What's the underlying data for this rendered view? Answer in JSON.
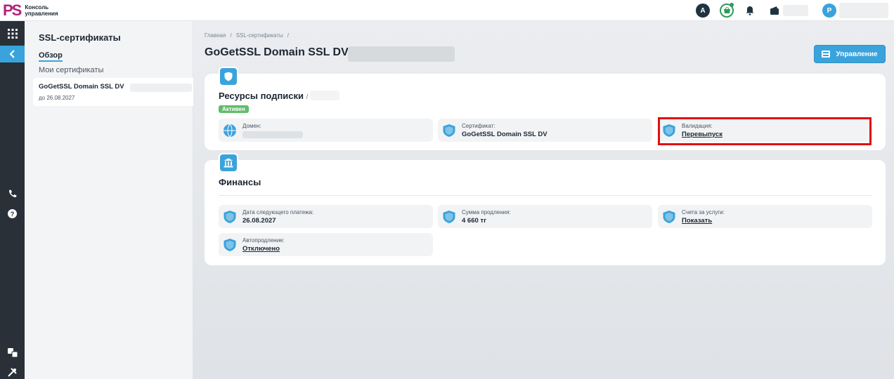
{
  "header": {
    "logo_mark": "PS",
    "logo_text_line1": "Консоль",
    "logo_text_line2": "управления",
    "account_initial": "A",
    "user_initial": "P",
    "accent": "#3aa3dc",
    "brand": "#b2247a"
  },
  "rail": {
    "icons": [
      "apps-grid-icon",
      "back-chevron-icon",
      "phone-icon",
      "help-icon",
      "translate-icon",
      "tools-icon"
    ]
  },
  "sidebar": {
    "title": "SSL-сертификаты",
    "nav": [
      {
        "label": "Обзор",
        "active": true
      },
      {
        "label": "Мои сертификаты",
        "active": false
      }
    ],
    "card": {
      "name": "GoGetSSL Domain SSL DV",
      "date": "до 26.08.2027"
    }
  },
  "main": {
    "breadcrumb": [
      "Главная",
      "/",
      "SSL-сертификаты",
      "/"
    ],
    "title": "GoGetSSL Domain SSL DV",
    "manage_button": "Управление",
    "subscription": {
      "title": "Ресурсы подписки",
      "title_sep": "/",
      "status": "Активен",
      "tiles": [
        {
          "label": "Домен:",
          "value": ""
        },
        {
          "label": "Сертификат:",
          "value": "GoGetSSL Domain SSL DV"
        },
        {
          "label": "Валидация:",
          "value": "Перевыпуск"
        }
      ]
    },
    "finance": {
      "title": "Финансы",
      "tiles": [
        {
          "label": "Дата следующего платежа:",
          "value": "26.08.2027"
        },
        {
          "label": "Сумма продления:",
          "value": "4 660 тг"
        },
        {
          "label": "Счета за услуги:",
          "value": "Показать"
        },
        {
          "label": "Автопродление:",
          "value": "Отключено"
        }
      ]
    }
  }
}
